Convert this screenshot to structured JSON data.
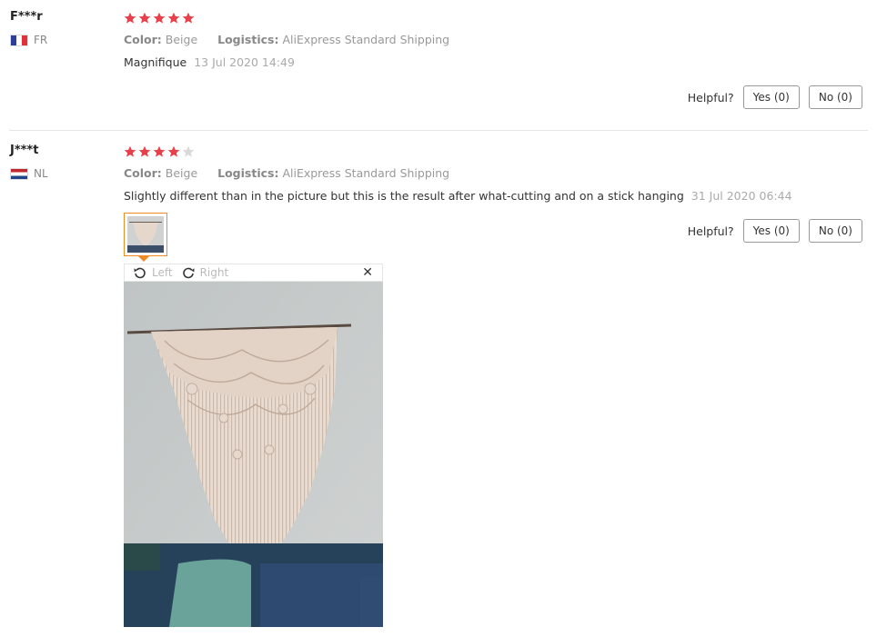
{
  "reviews": [
    {
      "user": "F***r",
      "country": "FR",
      "rating": 5,
      "color_label": "Color:",
      "color_value": "Beige",
      "logistics_label": "Logistics:",
      "logistics_value": "AliExpress Standard Shipping",
      "text": "Magnifique",
      "date": "13 Jul 2020 14:49",
      "helpful_label": "Helpful?",
      "yes_label": "Yes (0)",
      "no_label": "No (0)"
    },
    {
      "user": "J***t",
      "country": "NL",
      "rating": 4,
      "color_label": "Color:",
      "color_value": "Beige",
      "logistics_label": "Logistics:",
      "logistics_value": "AliExpress Standard Shipping",
      "text": "Slightly different than in the picture but this is the result after what-cutting and on a stick hanging",
      "date": "31 Jul 2020 06:44",
      "helpful_label": "Helpful?",
      "yes_label": "Yes (0)",
      "no_label": "No (0)"
    }
  ],
  "viewer": {
    "rotate_left_label": "Left",
    "rotate_right_label": "Right",
    "close_glyph": "✕"
  },
  "colors": {
    "star_filled": "#e8404a",
    "star_empty": "#d9d9d9",
    "thumb_border": "#f08a24"
  }
}
